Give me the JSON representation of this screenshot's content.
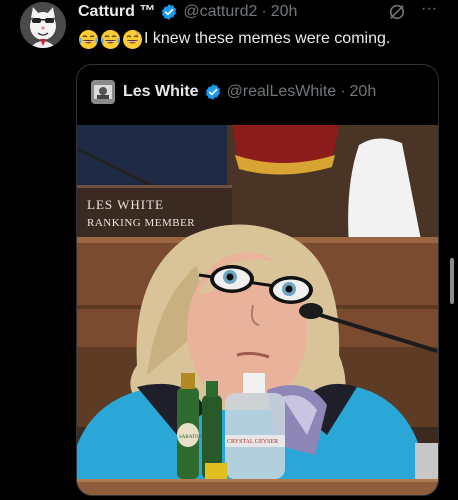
{
  "tweet": {
    "author_name": "Catturd ™",
    "handle": "@catturd2",
    "separator": "·",
    "time": "20h",
    "text": "I knew these memes were coming.",
    "emojis": [
      "face-with-tears-of-joy",
      "face-with-tears-of-joy",
      "grinning-face-with-sweat"
    ],
    "more_label": "···"
  },
  "quoted_tweet": {
    "author_name": "Les White",
    "handle": "@realLesWhite",
    "separator": "·",
    "time": "20h",
    "media": {
      "nameplate_line1": "LES WHITE",
      "nameplate_line2": "RANKING MEMBER",
      "bottle_label": "SARATOGA",
      "water_label": "CRYSTAL GEYSER"
    }
  },
  "colors": {
    "background": "#000000",
    "text_primary": "#e7e9ea",
    "text_secondary": "#71767b",
    "verified": "#1d9bf0",
    "border": "#2f3336"
  },
  "icons": {
    "verified": "verified-badge-icon",
    "grok": "grok-icon",
    "more": "more-icon"
  }
}
